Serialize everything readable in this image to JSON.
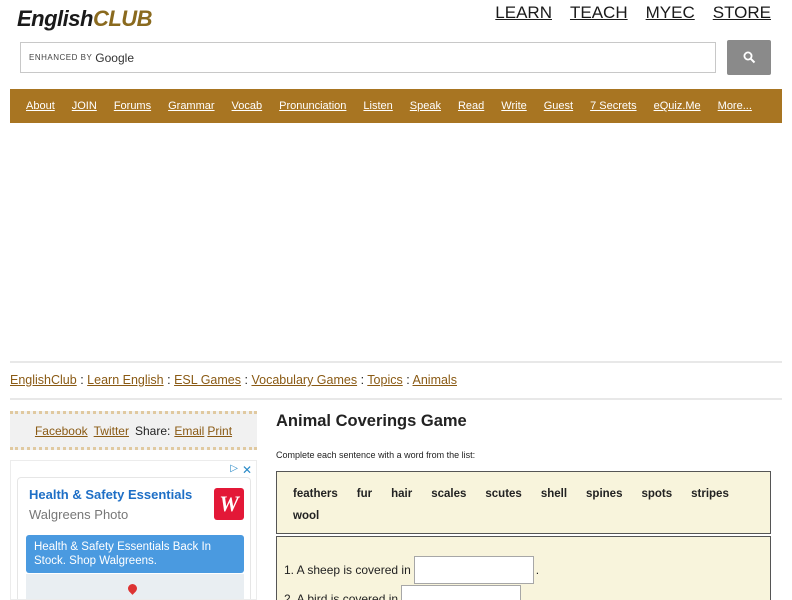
{
  "logo": {
    "part1": "English",
    "part2": "CLUB"
  },
  "topnav": [
    "LEARN",
    "TEACH",
    "MYEC",
    "STORE"
  ],
  "search": {
    "enhanced_by": "ENHANCED BY",
    "google": "Google"
  },
  "menu": [
    "About",
    "JOIN",
    "Forums",
    "Grammar",
    "Vocab",
    "Pronunciation",
    "Listen",
    "Speak",
    "Read",
    "Write",
    "Guest",
    "7 Secrets",
    "eQuiz.Me",
    "More..."
  ],
  "breadcrumb": {
    "items": [
      "EnglishClub",
      "Learn English",
      "ESL Games",
      "Vocabulary Games",
      "Topics",
      "Animals"
    ],
    "separator": ":"
  },
  "share": {
    "facebook": "Facebook",
    "twitter": "Twitter",
    "share_label": "Share:",
    "email": "Email",
    "print": "Print"
  },
  "ad": {
    "title": "Health & Safety Essentials",
    "subtitle": "Walgreens Photo",
    "logo_letter": "W",
    "body": "Health & Safety Essentials Back In Stock. Shop Walgreens.",
    "close": "✕",
    "adchoices": "▷"
  },
  "game": {
    "title": "Animal Coverings Game",
    "instructions": "Complete each sentence with a word from the list:",
    "words": [
      "feathers",
      "fur",
      "hair",
      "scales",
      "scutes",
      "shell",
      "spines",
      "spots",
      "stripes",
      "wool"
    ],
    "questions": [
      {
        "prefix": "1. A sheep is covered in",
        "suffix": ".",
        "value": ""
      },
      {
        "prefix": "2. A bird is covered in",
        "suffix": "",
        "value": ""
      }
    ]
  },
  "colors": {
    "brand_brown": "#a87522",
    "link_brown": "#8a5a14",
    "word_bg": "#f8f4dc"
  }
}
